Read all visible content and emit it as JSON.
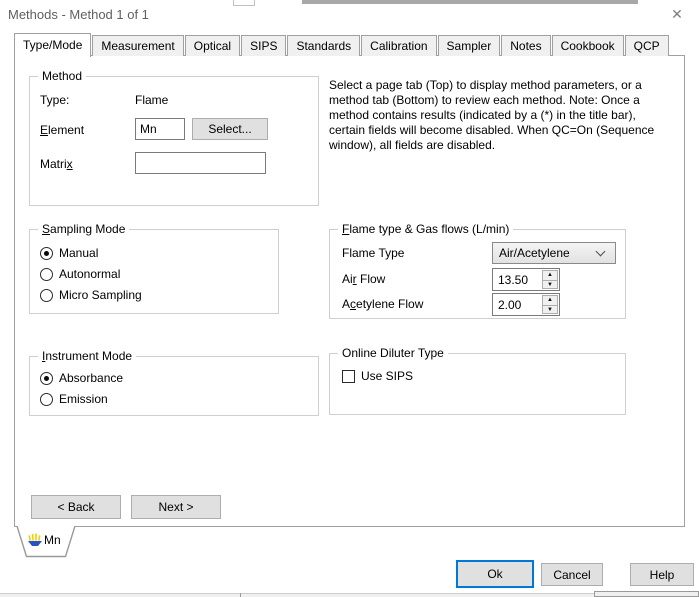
{
  "window": {
    "title": "Methods - Method 1 of 1"
  },
  "icons": {
    "close": "✕",
    "spin_up": "▲",
    "spin_down": "▼"
  },
  "tabs": {
    "items": [
      {
        "label": "Type/Mode",
        "active": true
      },
      {
        "label": "Measurement",
        "active": false
      },
      {
        "label": "Optical",
        "active": false
      },
      {
        "label": "SIPS",
        "active": false
      },
      {
        "label": "Standards",
        "active": false
      },
      {
        "label": "Calibration",
        "active": false
      },
      {
        "label": "Sampler",
        "active": false
      },
      {
        "label": "Notes",
        "active": false
      },
      {
        "label": "Cookbook",
        "active": false
      },
      {
        "label": "QCP",
        "active": false
      }
    ]
  },
  "method_group": {
    "title": "Method",
    "type_label": "Type:",
    "type_value": "Flame",
    "element_label": "Element",
    "element_value": "Mn",
    "select_button": "Select...",
    "matrix_label": "Matrix",
    "matrix_value": ""
  },
  "help_text": "Select a page tab (Top) to display method parameters, or a method tab (Bottom) to review each method. Note: Once a method contains results (indicated by a (*) in the title bar), certain fields will become disabled. When QC=On (Sequence window), all fields are disabled.",
  "sampling_mode": {
    "title": "Sampling Mode",
    "options": [
      {
        "label": "Manual",
        "selected": true
      },
      {
        "label": "Autonormal",
        "selected": false
      },
      {
        "label": "Micro Sampling",
        "selected": false
      }
    ]
  },
  "flame_group": {
    "title": "Flame type & Gas flows (L/min)",
    "flame_type_label": "Flame Type",
    "flame_type_value": "Air/Acetylene",
    "air_flow_label": "Air Flow",
    "air_flow_value": "13.50",
    "acetylene_flow_label": "Acetylene Flow",
    "acetylene_flow_value": "2.00"
  },
  "instrument_mode": {
    "title": "Instrument Mode",
    "options": [
      {
        "label": "Absorbance",
        "selected": true
      },
      {
        "label": "Emission",
        "selected": false
      }
    ]
  },
  "diluter_group": {
    "title": "Online Diluter Type",
    "checkbox_label": "Use SIPS",
    "checked": false
  },
  "wizard": {
    "back_label": "< Back",
    "next_label": "Next >"
  },
  "method_tabs": {
    "items": [
      {
        "label": "Mn",
        "icon": "flame-icon",
        "active": true
      }
    ]
  },
  "footer": {
    "ok_label": "Ok",
    "cancel_label": "Cancel",
    "help_label": "Help"
  }
}
